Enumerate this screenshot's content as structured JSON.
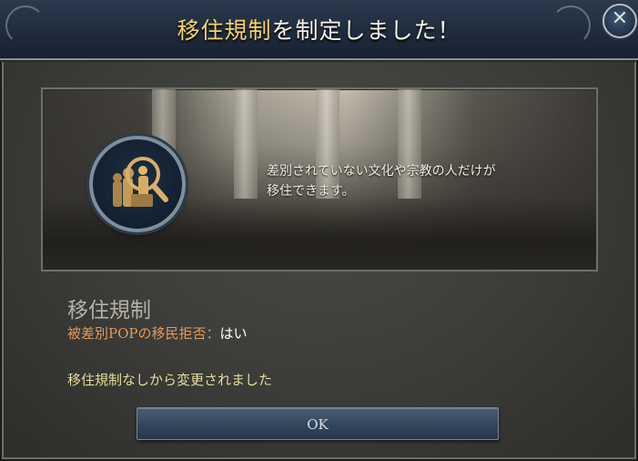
{
  "dialog": {
    "title_highlight": "移住規制",
    "title_rest": "を制定しました！",
    "close_icon": "close-icon"
  },
  "illustration": {
    "description_line1": "差別されていない文化や宗教の人だけが",
    "description_line2": "移住できます。",
    "emblem_icon": "magnifying-glass-migrant-icon"
  },
  "law": {
    "name": "移住規制",
    "effect_label": "被差別POPの移民拒否：",
    "effect_value": "はい",
    "changed_text": "移住規制なしから変更されました"
  },
  "buttons": {
    "ok_label": "OK"
  },
  "colors": {
    "title_highlight": "#f3d16a",
    "effect_label": "#e39a5a",
    "changed_text": "#e7dc9a",
    "header_bg": "#1f2c3e"
  }
}
